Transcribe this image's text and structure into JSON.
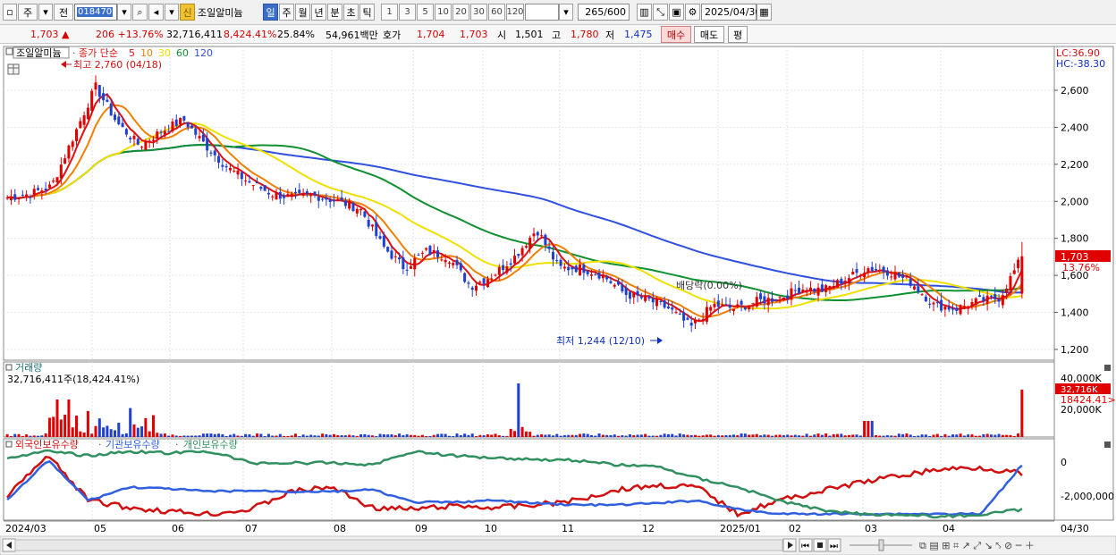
{
  "toolbar": {
    "type_label": "주",
    "prev_label": "전",
    "stock_code": "018470",
    "stock_name": "조일알미늄",
    "shin_label": "신",
    "periods": [
      {
        "label": "일",
        "active": true
      },
      {
        "label": "주",
        "active": false
      },
      {
        "label": "월",
        "active": false
      },
      {
        "label": "년",
        "active": false
      },
      {
        "label": "분",
        "active": false
      },
      {
        "label": "초",
        "active": false
      },
      {
        "label": "틱",
        "active": false
      }
    ],
    "intervals": [
      "1",
      "3",
      "5",
      "10",
      "20",
      "30",
      "60",
      "120"
    ],
    "count": "265",
    "count_max": "/600",
    "date": "2025/04/30"
  },
  "quote": {
    "price": "1,703",
    "arrow": "▲",
    "change": "206",
    "change_pct": "+13.76%",
    "volume": "32,716,411",
    "volume_ratio": "8,424.41%",
    "turnover": "25.84%",
    "amount": "54,961백만",
    "bid_label": "호가",
    "bid": "1,704",
    "ask": "1,703",
    "open_label": "시",
    "open": "1,501",
    "high_label": "고",
    "high": "1,780",
    "low_label": "저",
    "low": "1,475",
    "buy_label": "매수",
    "sell_label": "매도",
    "even_label": "평"
  },
  "colors": {
    "candle_up": "#e00000",
    "candle_down": "#2040d0",
    "ma5": "#e01010",
    "ma10": "#f08000",
    "ma30": "#f0e000",
    "ma60": "#109030",
    "ma120": "#3050e0",
    "foreign": "#d01010",
    "institution": "#3060e0",
    "individual": "#309060"
  },
  "price_panel": {
    "stock_name": "조일알미늄",
    "legend_prefix": "종가 단순",
    "ma_periods": [
      "5",
      "10",
      "30",
      "60",
      "120"
    ],
    "lc": "LC:36.90",
    "hc": "HC:-38.30",
    "max_marker": "최고 2,760 (04/18)",
    "min_marker": "최저 1,244 (12/10)",
    "dividend_note": "배당락(0.00%)",
    "price_tag": "1,703",
    "pct_tag": "13.76%",
    "y_ticks": [
      "2,600",
      "2,400",
      "2,200",
      "2,000",
      "1,800",
      "1,600",
      "1,400",
      "1,200"
    ]
  },
  "volume_panel": {
    "title": "거래량",
    "value": "32,716,411주(18,424.41%)",
    "y_ticks": [
      "40,000K",
      "20,000K"
    ],
    "tag_value": "32,716K",
    "tag_pct": "18424.41>"
  },
  "holdings_panel": {
    "legends": [
      "외국인보유수량",
      "기관보유수량",
      "개인보유수량"
    ],
    "y_ticks": [
      "0",
      "-2,000,000"
    ]
  },
  "x_axis": {
    "labels": [
      "2024/03",
      "05",
      "06",
      "07",
      "08",
      "09",
      "10",
      "11",
      "12",
      "2025/01",
      "02",
      "03",
      "04"
    ],
    "end_label": "04/30"
  },
  "chart_data": {
    "type": "candlestick",
    "y_range": [
      1200,
      2800
    ],
    "highest": {
      "value": 2760,
      "date": "04/18"
    },
    "lowest": {
      "value": 1244,
      "date": "12/10"
    },
    "last": {
      "close": 1703,
      "open": 1501,
      "high": 1780,
      "low": 1475,
      "change_pct": 13.76
    },
    "close_path": [
      2020,
      2040,
      2080,
      2350,
      2620,
      2420,
      2300,
      2380,
      2440,
      2300,
      2180,
      2100,
      2040,
      2020,
      2030,
      2000,
      1960,
      1760,
      1640,
      1730,
      1700,
      1540,
      1600,
      1700,
      1850,
      1640,
      1640,
      1600,
      1500,
      1470,
      1420,
      1320,
      1440,
      1420,
      1460,
      1480,
      1530,
      1520,
      1580,
      1640,
      1620,
      1560,
      1440,
      1420,
      1460,
      1480,
      1700
    ]
  }
}
